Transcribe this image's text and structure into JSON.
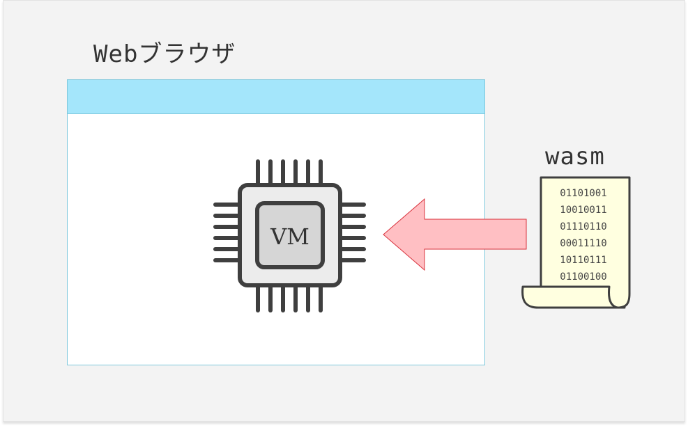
{
  "browser": {
    "label": "Webブラウザ"
  },
  "vm": {
    "label": "VM"
  },
  "wasm": {
    "label": "wasm",
    "binary_lines": [
      "01101001",
      "10010011",
      "01110110",
      "00011110",
      "10110111",
      "01100100"
    ]
  },
  "icons": {
    "chip": "cpu-chip-icon",
    "arrow": "left-arrow-icon",
    "scroll": "scroll-document-icon"
  },
  "colors": {
    "background": "#f3f3f3",
    "browser_titlebar": "#a4e6fb",
    "browser_border": "#7ec8dc",
    "chip_stroke": "#3f3f3f",
    "chip_fill": "#ececec",
    "chip_core": "#d6d6d6",
    "arrow_fill": "#ffbfc3",
    "arrow_stroke": "#d8303b",
    "scroll_fill": "#ffffe0"
  }
}
